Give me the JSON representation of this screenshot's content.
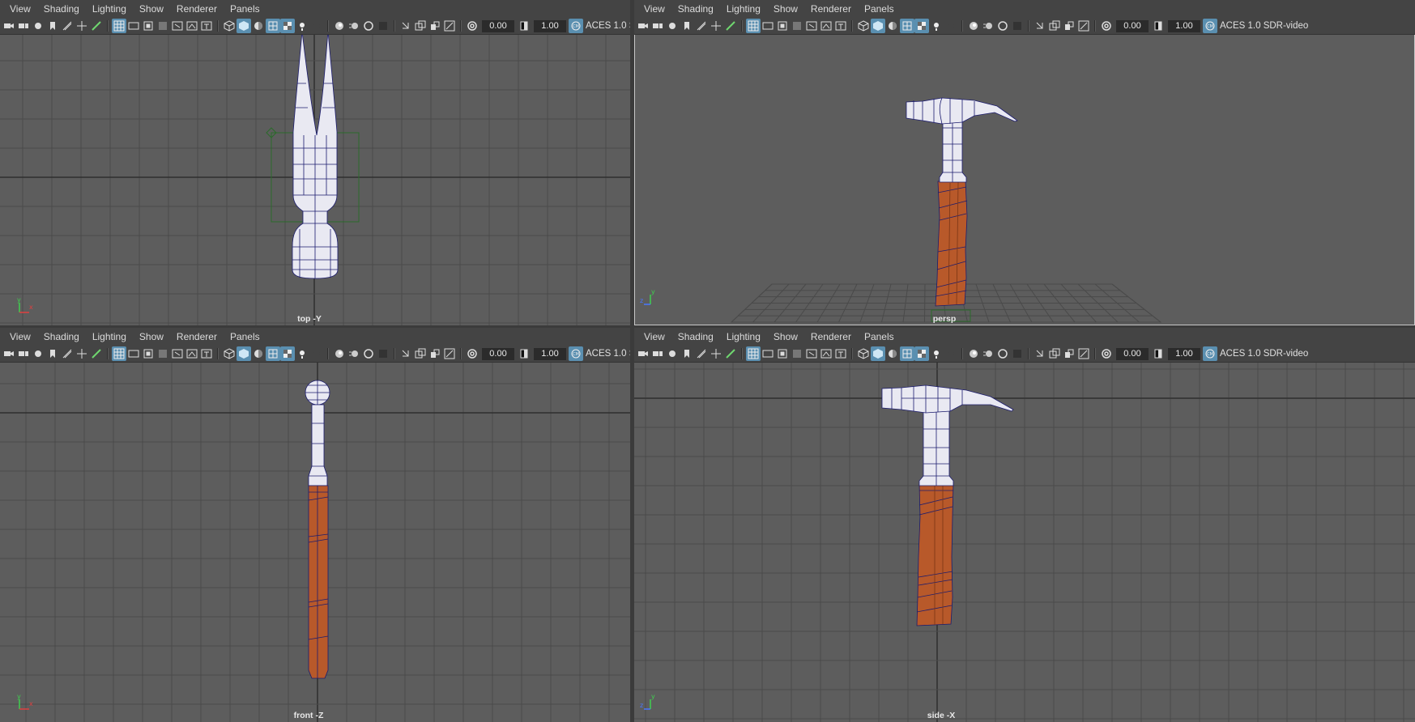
{
  "menus": [
    "View",
    "Shading",
    "Lighting",
    "Show",
    "Renderer",
    "Panels"
  ],
  "toolbar": {
    "exposure": "0.00",
    "gamma": "1.00",
    "color_space": "ACES 1.0 SDR-video"
  },
  "panels": {
    "top": {
      "camera": "top -Y"
    },
    "persp": {
      "camera": "persp"
    },
    "front": {
      "camera": "front -Z"
    },
    "side": {
      "camera": "side -X"
    }
  },
  "axis_labels": {
    "x": "x",
    "y": "y",
    "z": "z"
  },
  "colors": {
    "viewport_bg": "#5d5d5d",
    "grid": "#4a4a4a",
    "grid_axis": "#2f2f2f",
    "wire": "#1c1c6e",
    "metal": "#e9e9f2",
    "wood": "#b8592a",
    "highlight_green": "#2a6b2a"
  }
}
